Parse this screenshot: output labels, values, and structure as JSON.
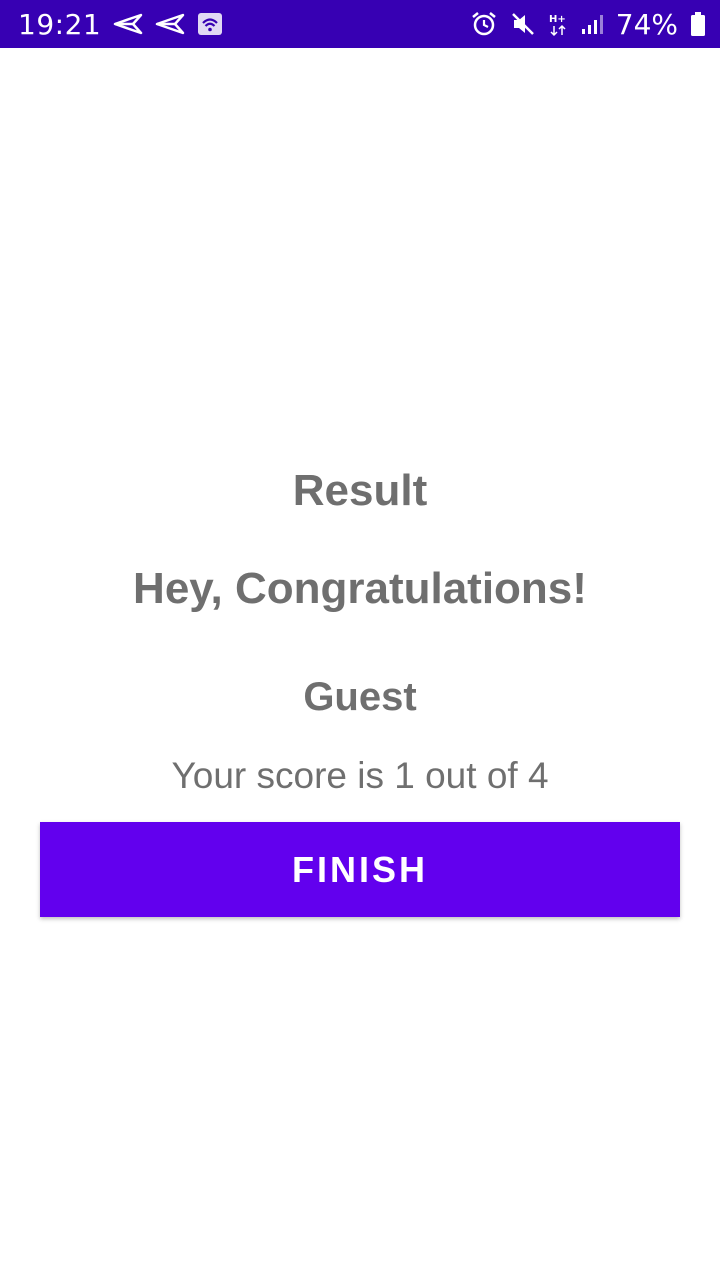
{
  "status_bar": {
    "time": "19:21",
    "battery_percent": "74%",
    "network_type": "H+",
    "icons_left": [
      "send-icon",
      "send-icon",
      "wifi-icon"
    ],
    "icons_right": [
      "alarm-icon",
      "mute-icon",
      "network-type-icon",
      "signal-icon",
      "battery-icon"
    ],
    "background_color": "#3700b3"
  },
  "result": {
    "title": "Result",
    "congratulations": "Hey, Congratulations!",
    "name": "Guest",
    "score_text": "Your score is 1 out of 4"
  },
  "actions": {
    "finish_label": "FINISH",
    "finish_color": "#6200ee"
  }
}
